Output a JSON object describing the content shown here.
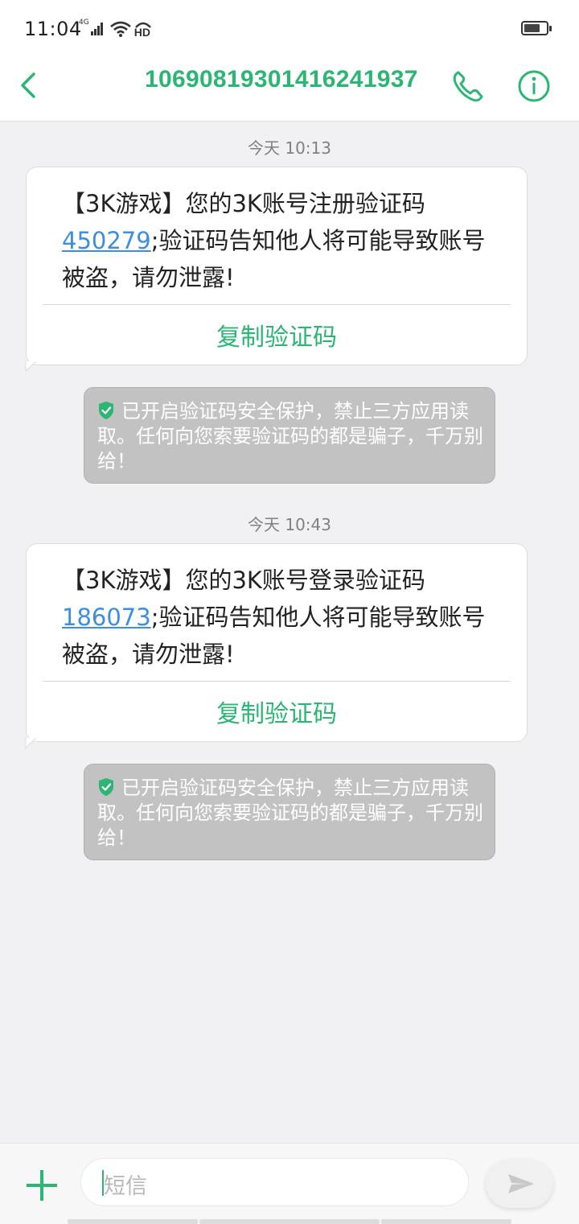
{
  "status_bar": {
    "time": "11:04",
    "network": "4G",
    "hd_label": "HD",
    "battery_level": 0.72
  },
  "header": {
    "title": "10690819301416241937",
    "accent_color": "#2bb673"
  },
  "messages": [
    {
      "timestamp": "今天 10:13",
      "text_prefix": "【3K游戏】您的3K账号注册验证码",
      "code": "450279",
      "text_suffix": ";验证码告知他人将可能导致账号被盗，请勿泄露!",
      "copy_label": "复制验证码",
      "notice": "已开启验证码安全保护，禁止三方应用读取。任何向您索要验证码的都是骗子，千万别给！"
    },
    {
      "timestamp": "今天 10:43",
      "text_prefix": "【3K游戏】您的3K账号登录验证码",
      "code": "186073",
      "text_suffix": ";验证码告知他人将可能导致账号被盗，请勿泄露!",
      "copy_label": "复制验证码",
      "notice": "已开启验证码安全保护，禁止三方应用读取。任何向您索要验证码的都是骗子，千万别给！"
    }
  ],
  "composer": {
    "placeholder": "短信",
    "add_icon": "plus-icon",
    "send_icon": "send-icon"
  }
}
